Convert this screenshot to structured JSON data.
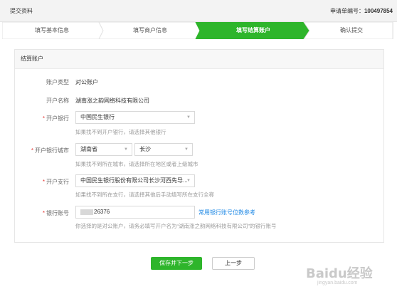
{
  "header": {
    "title": "提交资料",
    "order_label": "申请单编号：",
    "order_number": "100497854"
  },
  "steps": [
    {
      "label": "填写基本信息",
      "active": false
    },
    {
      "label": "填写商户信息",
      "active": false
    },
    {
      "label": "填写结算账户",
      "active": true
    },
    {
      "label": "确认提交",
      "active": false
    }
  ],
  "panel": {
    "title": "结算账户",
    "account_type_label": "账户类型",
    "account_type_value": "对公账户",
    "account_name_label": "开户名称",
    "account_name_value": "湖南涨之韵网络科技有限公司",
    "bank_label": "开户银行",
    "bank_value": "中国民生银行",
    "bank_hint": "如果找不到开户银行，请选择其他银行",
    "city_label": "开户银行城市",
    "province_value": "湖南省",
    "city_value": "长沙",
    "city_hint": "如果找不到所在城市，请选择所在地区或者上级城市",
    "branch_label": "开户支行",
    "branch_value": "中国民生银行股份有限公司长沙河西先导...",
    "branch_hint": "如果找不到所在支行，请选择其他后手动填写所在支行全称",
    "account_no_label": "银行账号",
    "account_no_value": "26376",
    "account_no_link": "常用银行账号位数参考",
    "account_no_hint": "你选择的是对公账户，请务必填写开户名为“湖南涨之韵网络科技有限公司”的银行账号"
  },
  "buttons": {
    "save_next": "保存并下一步",
    "prev": "上一步"
  },
  "watermark": {
    "text": "Baidu经验",
    "sub": "jingyan.baidu.com"
  },
  "colors": {
    "accent": "#2eb52b",
    "required": "#e53935",
    "link": "#1e88e5"
  }
}
